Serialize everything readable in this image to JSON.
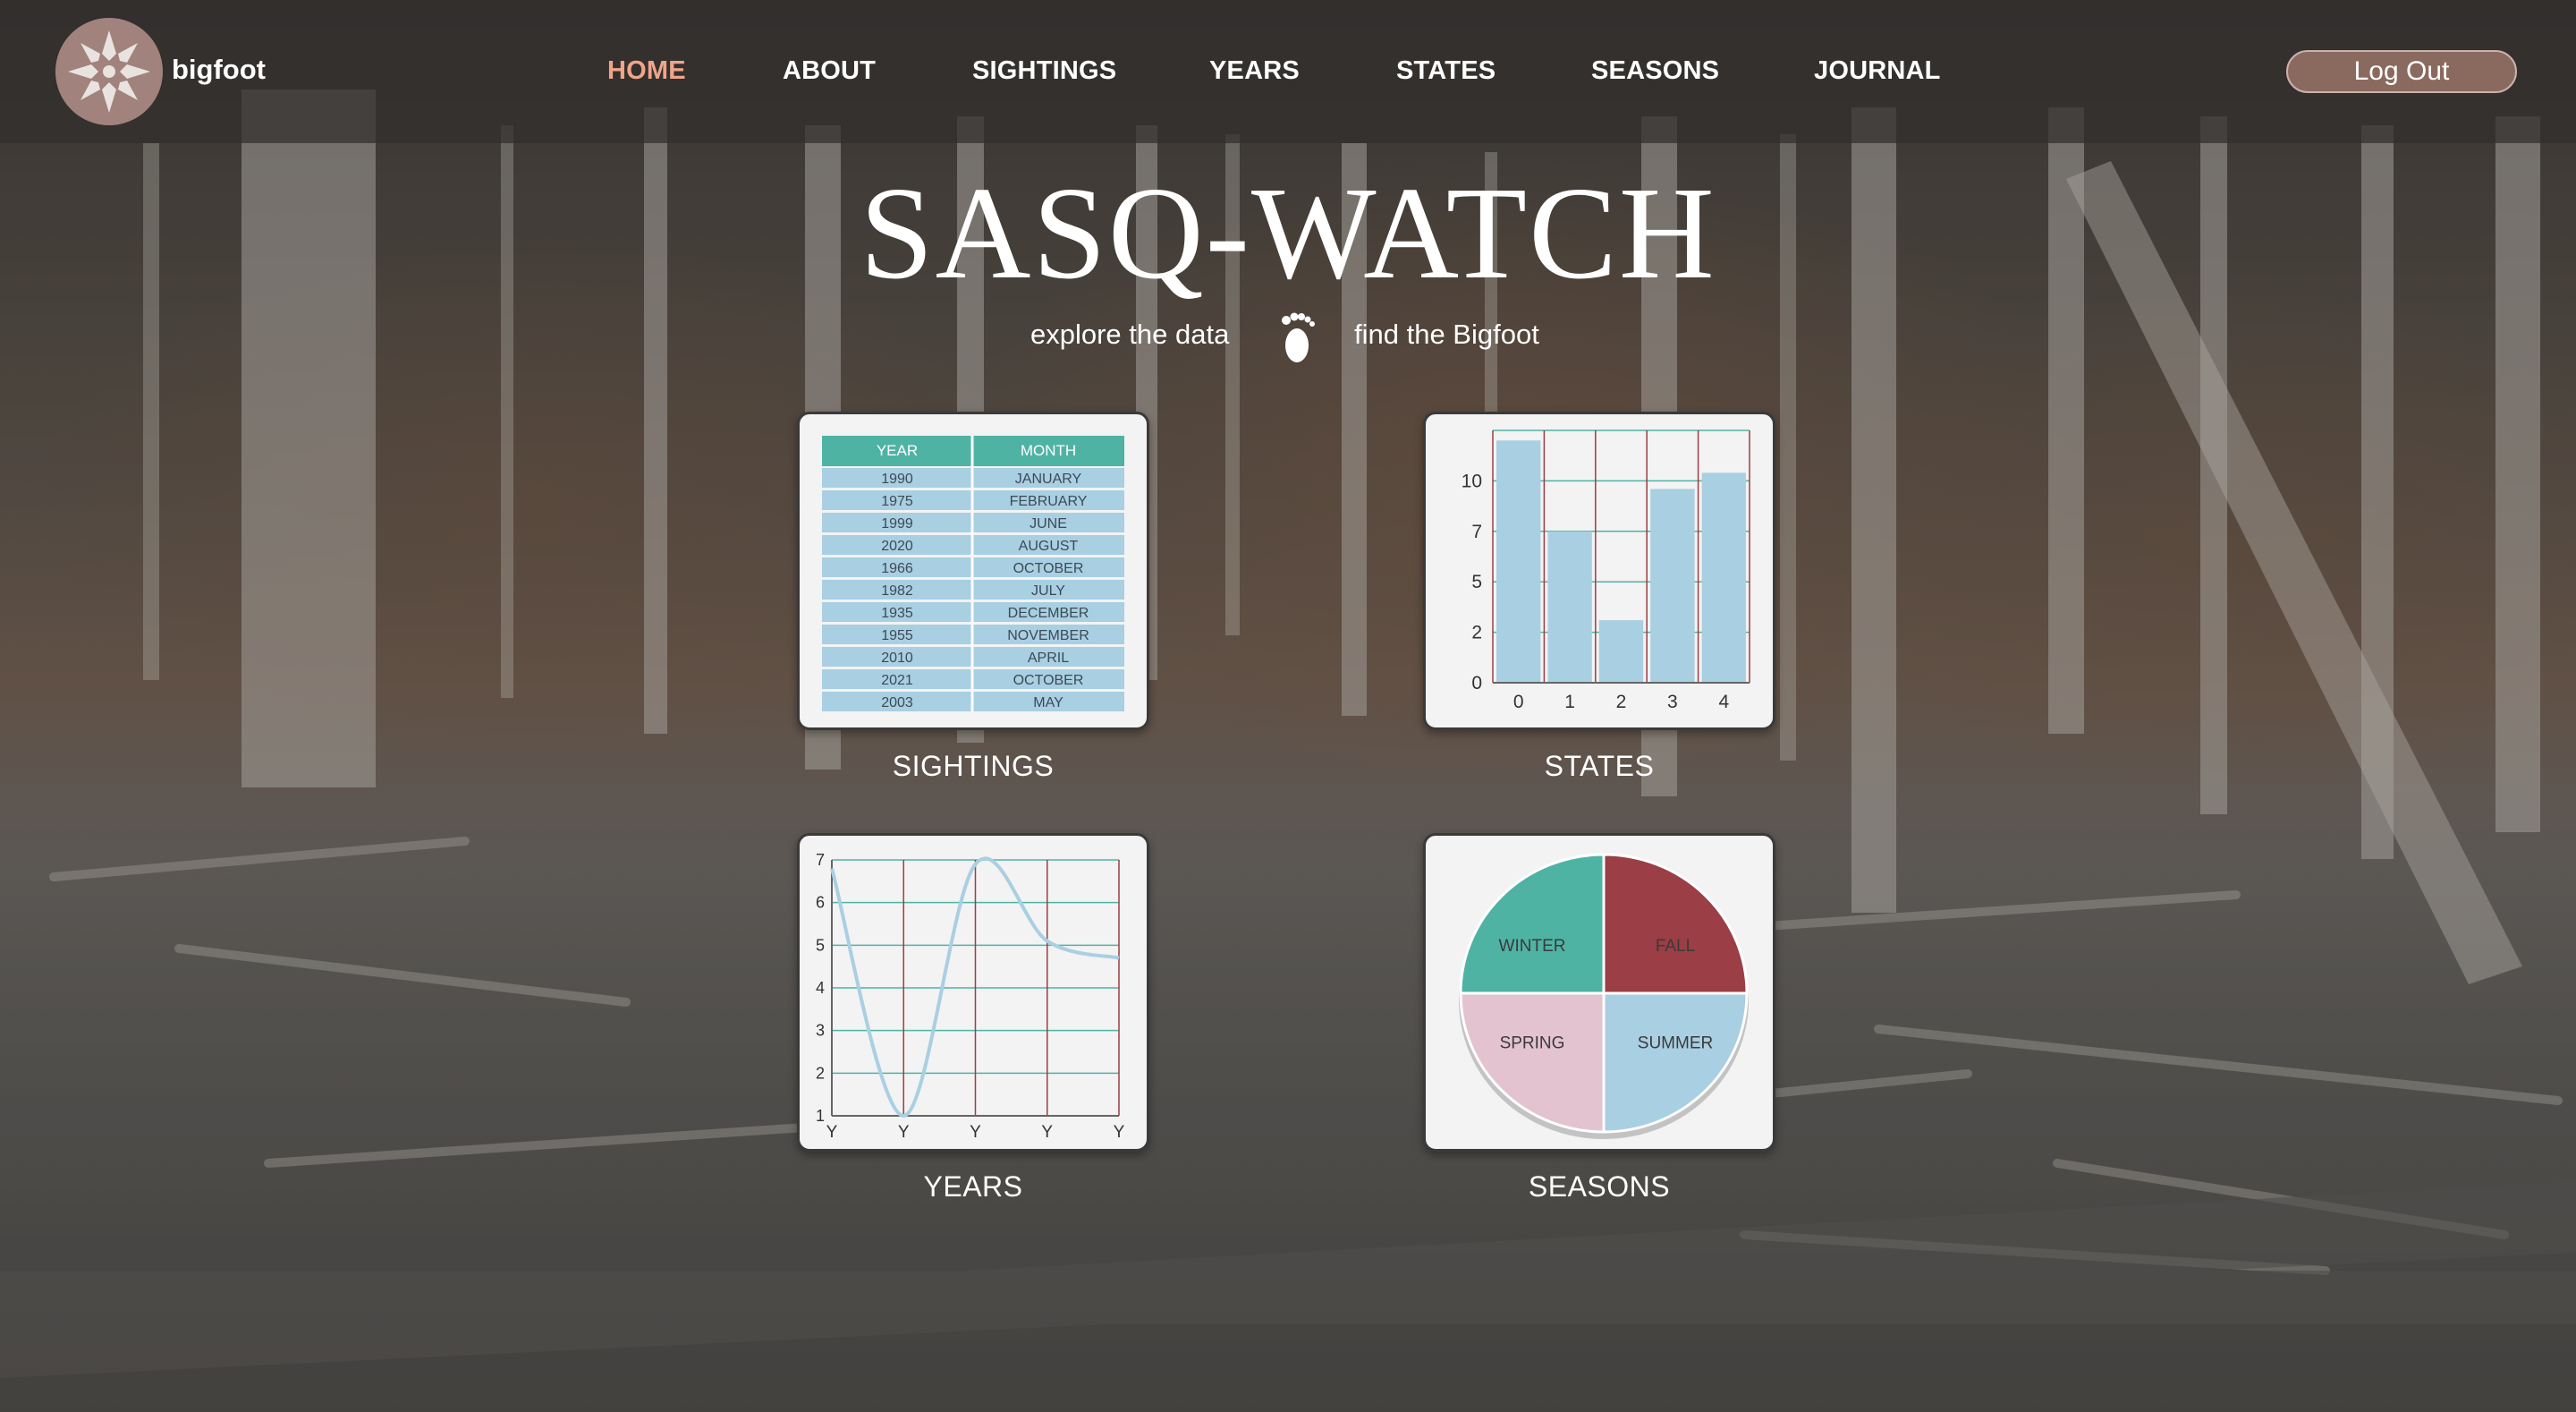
{
  "brand": {
    "name": "bigfoot"
  },
  "nav": {
    "links": [
      {
        "label": "HOME",
        "active": true
      },
      {
        "label": "ABOUT",
        "active": false
      },
      {
        "label": "SIGHTINGS",
        "active": false
      },
      {
        "label": "YEARS",
        "active": false
      },
      {
        "label": "STATES",
        "active": false
      },
      {
        "label": "SEASONS",
        "active": false
      },
      {
        "label": "JOURNAL",
        "active": false
      }
    ],
    "logout_label": "Log Out"
  },
  "hero": {
    "title": "SASQ-WATCH",
    "tagline_left": "explore the data",
    "tagline_right": "find the Bigfoot"
  },
  "cards": {
    "sightings": {
      "label": "SIGHTINGS",
      "table": {
        "headers": [
          "YEAR",
          "MONTH"
        ],
        "rows": [
          [
            "1990",
            "JANUARY"
          ],
          [
            "1975",
            "FEBRUARY"
          ],
          [
            "1999",
            "JUNE"
          ],
          [
            "2020",
            "AUGUST"
          ],
          [
            "1966",
            "OCTOBER"
          ],
          [
            "1982",
            "JULY"
          ],
          [
            "1935",
            "DECEMBER"
          ],
          [
            "1955",
            "NOVEMBER"
          ],
          [
            "2010",
            "APRIL"
          ],
          [
            "2021",
            "OCTOBER"
          ],
          [
            "2003",
            "MAY"
          ]
        ]
      }
    },
    "states": {
      "label": "STATES",
      "chart": {
        "type": "bar",
        "categories": [
          "0",
          "1",
          "2",
          "3",
          "4"
        ],
        "values": [
          12,
          7.5,
          3.1,
          9.6,
          10.4
        ],
        "yticks": [
          "0",
          "2",
          "5",
          "7",
          "10"
        ],
        "ytick_values": [
          0,
          2.5,
          5,
          7.5,
          10
        ],
        "ylim": [
          0,
          12.5
        ]
      }
    },
    "years": {
      "label": "YEARS",
      "chart": {
        "type": "line",
        "xticks": [
          "Y",
          "Y",
          "Y",
          "Y",
          "Y"
        ],
        "yticks": [
          "1",
          "2",
          "3",
          "4",
          "5",
          "6",
          "7"
        ],
        "ylim": [
          1,
          7
        ]
      }
    },
    "seasons": {
      "label": "SEASONS",
      "chart": {
        "type": "pie",
        "slices": [
          {
            "label": "WINTER",
            "value": 25,
            "color": "#4fb3a4"
          },
          {
            "label": "FALL",
            "value": 25,
            "color": "#9b3e45"
          },
          {
            "label": "SPRING",
            "value": 25,
            "color": "#e4c3d0"
          },
          {
            "label": "SUMMER",
            "value": 25,
            "color": "#a9cfe2"
          }
        ]
      }
    }
  },
  "colors": {
    "nav_active": "#f0a58a",
    "teal": "#4fb3a4",
    "light_blue": "#a9cfe2",
    "maroon": "#9b3e45",
    "logout_bg": "#8a6a5f"
  },
  "chart_data": [
    {
      "type": "bar",
      "categories": [
        "0",
        "1",
        "2",
        "3",
        "4"
      ],
      "values": [
        12,
        7.5,
        3.1,
        9.6,
        10.4
      ],
      "title": "",
      "xlabel": "",
      "ylabel": "",
      "ylim": [
        0,
        12.5
      ],
      "grid": true
    },
    {
      "type": "line",
      "x": [
        "Y",
        "Y",
        "Y",
        "Y",
        "Y"
      ],
      "series": [
        {
          "values": [
            6.8,
            1.0,
            6.9,
            5.1,
            4.7
          ]
        }
      ],
      "title": "",
      "xlabel": "",
      "ylabel": "",
      "ylim": [
        1,
        7
      ],
      "grid": true
    },
    {
      "type": "pie",
      "categories": [
        "WINTER",
        "FALL",
        "SPRING",
        "SUMMER"
      ],
      "values": [
        25,
        25,
        25,
        25
      ],
      "title": ""
    }
  ]
}
